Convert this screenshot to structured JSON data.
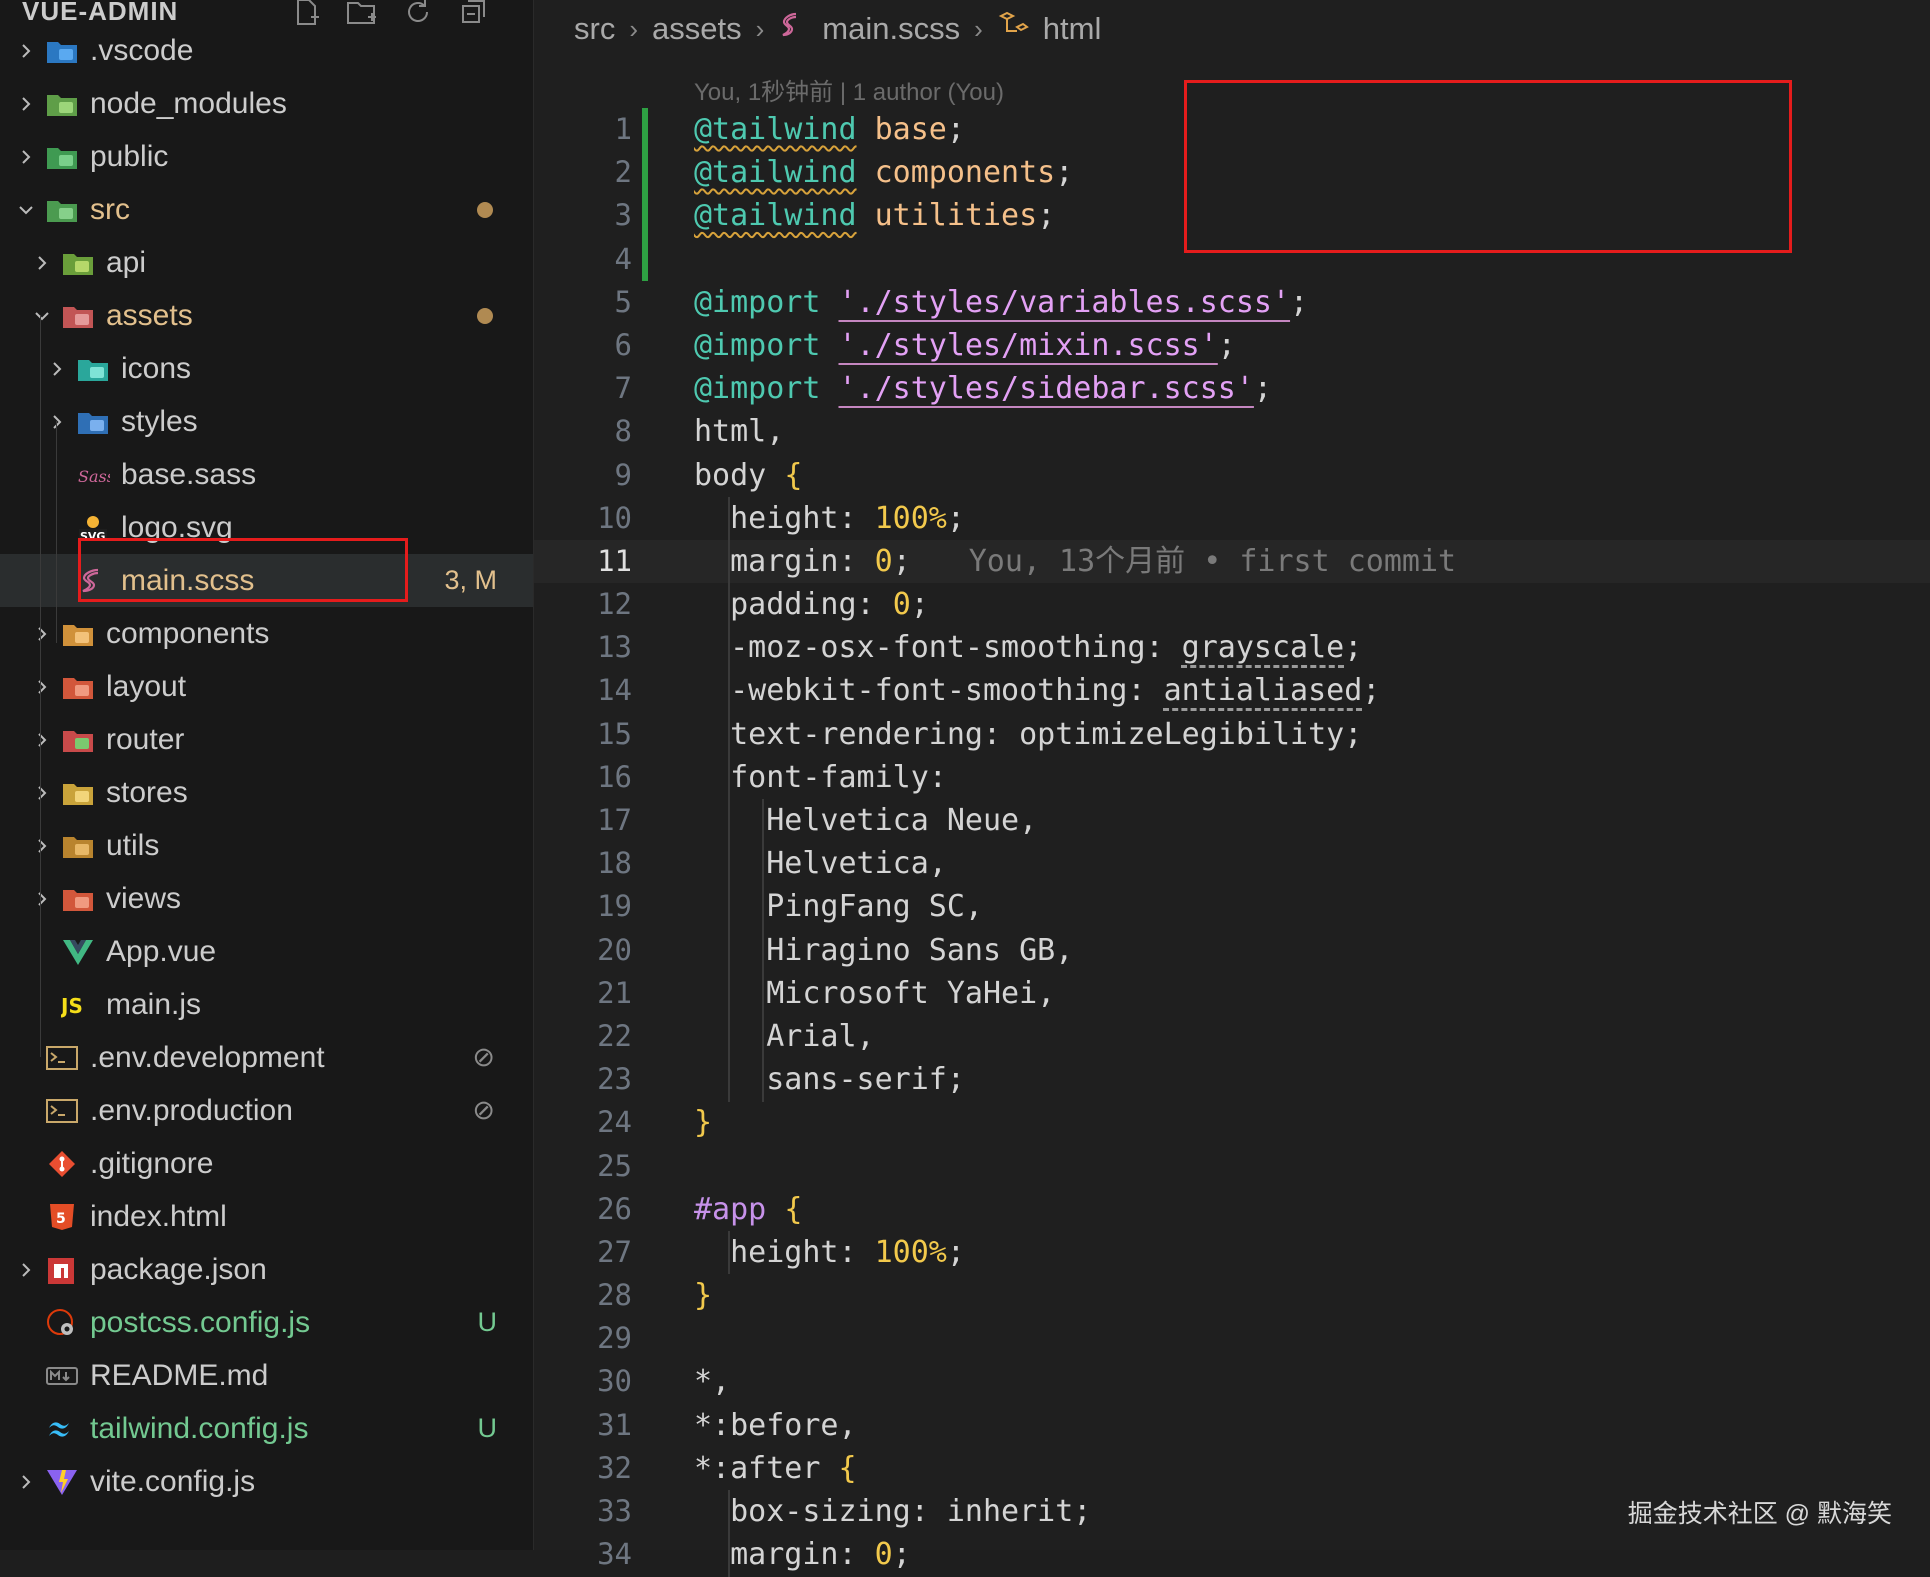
{
  "explorer": {
    "title": "VUE-ADMIN",
    "actions": [
      "new-file-icon",
      "new-folder-icon",
      "refresh-icon",
      "collapse-all-icon"
    ],
    "items": [
      {
        "label": ".vscode",
        "level": 1,
        "chevron": "right",
        "icon": "vscode-folder-icon",
        "color": "#cccccc"
      },
      {
        "label": "node_modules",
        "level": 1,
        "chevron": "right",
        "icon": "node-folder-icon",
        "color": "#cccccc"
      },
      {
        "label": "public",
        "level": 1,
        "chevron": "right",
        "icon": "public-folder-icon",
        "color": "#cccccc"
      },
      {
        "label": "src",
        "level": 1,
        "chevron": "down",
        "icon": "src-folder-icon",
        "color": "#e2c08d",
        "dot": true
      },
      {
        "label": "api",
        "level": 2,
        "chevron": "right",
        "icon": "api-folder-icon",
        "color": "#cccccc"
      },
      {
        "label": "assets",
        "level": 2,
        "chevron": "down",
        "icon": "assets-folder-icon",
        "color": "#e2c08d",
        "dot": true
      },
      {
        "label": "icons",
        "level": 3,
        "chevron": "right",
        "icon": "icons-folder-icon",
        "color": "#cccccc"
      },
      {
        "label": "styles",
        "level": 3,
        "chevron": "right",
        "icon": "styles-folder-icon",
        "color": "#cccccc"
      },
      {
        "label": "base.sass",
        "level": 3,
        "chevron": "",
        "icon": "sass-file-icon",
        "color": "#cccccc"
      },
      {
        "label": "logo.svg",
        "level": 3,
        "chevron": "",
        "icon": "svg-file-icon",
        "color": "#cccccc"
      },
      {
        "label": "main.scss",
        "level": 3,
        "chevron": "",
        "icon": "scss-file-icon",
        "color": "#e2c08d",
        "badge": "3, M",
        "badge_color": "#e2c08d",
        "selected": true
      },
      {
        "label": "components",
        "level": 2,
        "chevron": "right",
        "icon": "components-folder-icon",
        "color": "#cccccc"
      },
      {
        "label": "layout",
        "level": 2,
        "chevron": "right",
        "icon": "layout-folder-icon",
        "color": "#cccccc"
      },
      {
        "label": "router",
        "level": 2,
        "chevron": "right",
        "icon": "router-folder-icon",
        "color": "#cccccc"
      },
      {
        "label": "stores",
        "level": 2,
        "chevron": "right",
        "icon": "stores-folder-icon",
        "color": "#cccccc"
      },
      {
        "label": "utils",
        "level": 2,
        "chevron": "right",
        "icon": "utils-folder-icon",
        "color": "#cccccc"
      },
      {
        "label": "views",
        "level": 2,
        "chevron": "right",
        "icon": "views-folder-icon",
        "color": "#cccccc"
      },
      {
        "label": "App.vue",
        "level": 2,
        "chevron": "",
        "icon": "vue-file-icon",
        "color": "#cccccc"
      },
      {
        "label": "main.js",
        "level": 2,
        "chevron": "",
        "icon": "js-file-icon",
        "color": "#cccccc"
      },
      {
        "label": ".env.development",
        "level": 1,
        "chevron": "",
        "icon": "env-file-icon",
        "color": "#cccccc",
        "ignored": true
      },
      {
        "label": ".env.production",
        "level": 1,
        "chevron": "",
        "icon": "env-file-icon",
        "color": "#cccccc",
        "ignored": true
      },
      {
        "label": ".gitignore",
        "level": 1,
        "chevron": "",
        "icon": "git-file-icon",
        "color": "#cccccc"
      },
      {
        "label": "index.html",
        "level": 1,
        "chevron": "",
        "icon": "html-file-icon",
        "color": "#cccccc"
      },
      {
        "label": "package.json",
        "level": 1,
        "chevron": "right",
        "icon": "npm-file-icon",
        "color": "#cccccc"
      },
      {
        "label": "postcss.config.js",
        "level": 1,
        "chevron": "",
        "icon": "postcss-file-icon",
        "color": "#73c991",
        "badge": "U",
        "badge_color": "#73c991"
      },
      {
        "label": "README.md",
        "level": 1,
        "chevron": "",
        "icon": "markdown-file-icon",
        "color": "#cccccc"
      },
      {
        "label": "tailwind.config.js",
        "level": 1,
        "chevron": "",
        "icon": "tailwind-file-icon",
        "color": "#73c991",
        "badge": "U",
        "badge_color": "#73c991"
      },
      {
        "label": "vite.config.js",
        "level": 1,
        "chevron": "right",
        "icon": "vite-file-icon",
        "color": "#cccccc"
      }
    ]
  },
  "breadcrumb": {
    "parts": [
      "src",
      "assets",
      "main.scss",
      "html"
    ]
  },
  "blame_header": "You, 1秒钟前 | 1 author (You)",
  "current_line_blame": "You, 13个月前 • first commit",
  "current_line": 11,
  "code_lines": [
    [
      [
        "@tailwind",
        "at"
      ],
      [
        " ",
        ""
      ],
      [
        "base",
        "val"
      ],
      [
        ";",
        ""
      ]
    ],
    [
      [
        "@tailwind",
        "at"
      ],
      [
        " ",
        ""
      ],
      [
        "components",
        "val"
      ],
      [
        ";",
        ""
      ]
    ],
    [
      [
        "@tailwind",
        "at"
      ],
      [
        " ",
        ""
      ],
      [
        "utilities",
        "val"
      ],
      [
        ";",
        ""
      ]
    ],
    [],
    [
      [
        "@import",
        "imp"
      ],
      [
        " ",
        ""
      ],
      [
        "'./styles/variables.scss'",
        "str"
      ],
      [
        ";",
        ""
      ]
    ],
    [
      [
        "@import",
        "imp"
      ],
      [
        " ",
        ""
      ],
      [
        "'./styles/mixin.scss'",
        "str"
      ],
      [
        ";",
        ""
      ]
    ],
    [
      [
        "@import",
        "imp"
      ],
      [
        " ",
        ""
      ],
      [
        "'./styles/sidebar.scss'",
        "str"
      ],
      [
        ";",
        ""
      ]
    ],
    [
      [
        "html,",
        ""
      ]
    ],
    [
      [
        "body ",
        ""
      ],
      [
        "{",
        "br"
      ]
    ],
    [
      [
        "  height: ",
        ""
      ],
      [
        "100%",
        "num"
      ],
      [
        ";",
        ""
      ]
    ],
    [
      [
        "  margin: ",
        ""
      ],
      [
        "0",
        "num"
      ],
      [
        ";",
        ""
      ]
    ],
    [
      [
        "  padding: ",
        ""
      ],
      [
        "0",
        "num"
      ],
      [
        ";",
        ""
      ]
    ],
    [
      [
        "  -moz-osx-font-smoothing: ",
        ""
      ],
      [
        "grayscale",
        "dash"
      ],
      [
        ";",
        ""
      ]
    ],
    [
      [
        "  -webkit-font-smoothing: ",
        ""
      ],
      [
        "antialiased",
        "dash"
      ],
      [
        ";",
        ""
      ]
    ],
    [
      [
        "  text-rendering: optimizeLegibility;",
        ""
      ]
    ],
    [
      [
        "  font-family:",
        ""
      ]
    ],
    [
      [
        "    Helvetica Neue,",
        ""
      ]
    ],
    [
      [
        "    Helvetica,",
        ""
      ]
    ],
    [
      [
        "    PingFang SC,",
        ""
      ]
    ],
    [
      [
        "    Hiragino Sans GB,",
        ""
      ]
    ],
    [
      [
        "    Microsoft YaHei,",
        ""
      ]
    ],
    [
      [
        "    Arial,",
        ""
      ]
    ],
    [
      [
        "    sans-serif;",
        ""
      ]
    ],
    [
      [
        "}",
        "br"
      ]
    ],
    [],
    [
      [
        "#app",
        "id"
      ],
      [
        " ",
        ""
      ],
      [
        "{",
        "br"
      ]
    ],
    [
      [
        "  height: ",
        ""
      ],
      [
        "100%",
        "num"
      ],
      [
        ";",
        ""
      ]
    ],
    [
      [
        "}",
        "br"
      ]
    ],
    [],
    [
      [
        "*,",
        ""
      ]
    ],
    [
      [
        "*:before,",
        ""
      ]
    ],
    [
      [
        "*:after ",
        ""
      ],
      [
        "{",
        "br"
      ]
    ],
    [
      [
        "  box-sizing: inherit;",
        ""
      ]
    ],
    [
      [
        "  margin: ",
        ""
      ],
      [
        "0",
        "num"
      ],
      [
        ";",
        ""
      ]
    ]
  ],
  "watermark": "掘金技术社区 @ 默海笑",
  "colors": {
    "modified": "#e2c08d",
    "untracked": "#73c991",
    "highlight_box": "#e51c1c",
    "git_added_bar": "#2ea043"
  }
}
